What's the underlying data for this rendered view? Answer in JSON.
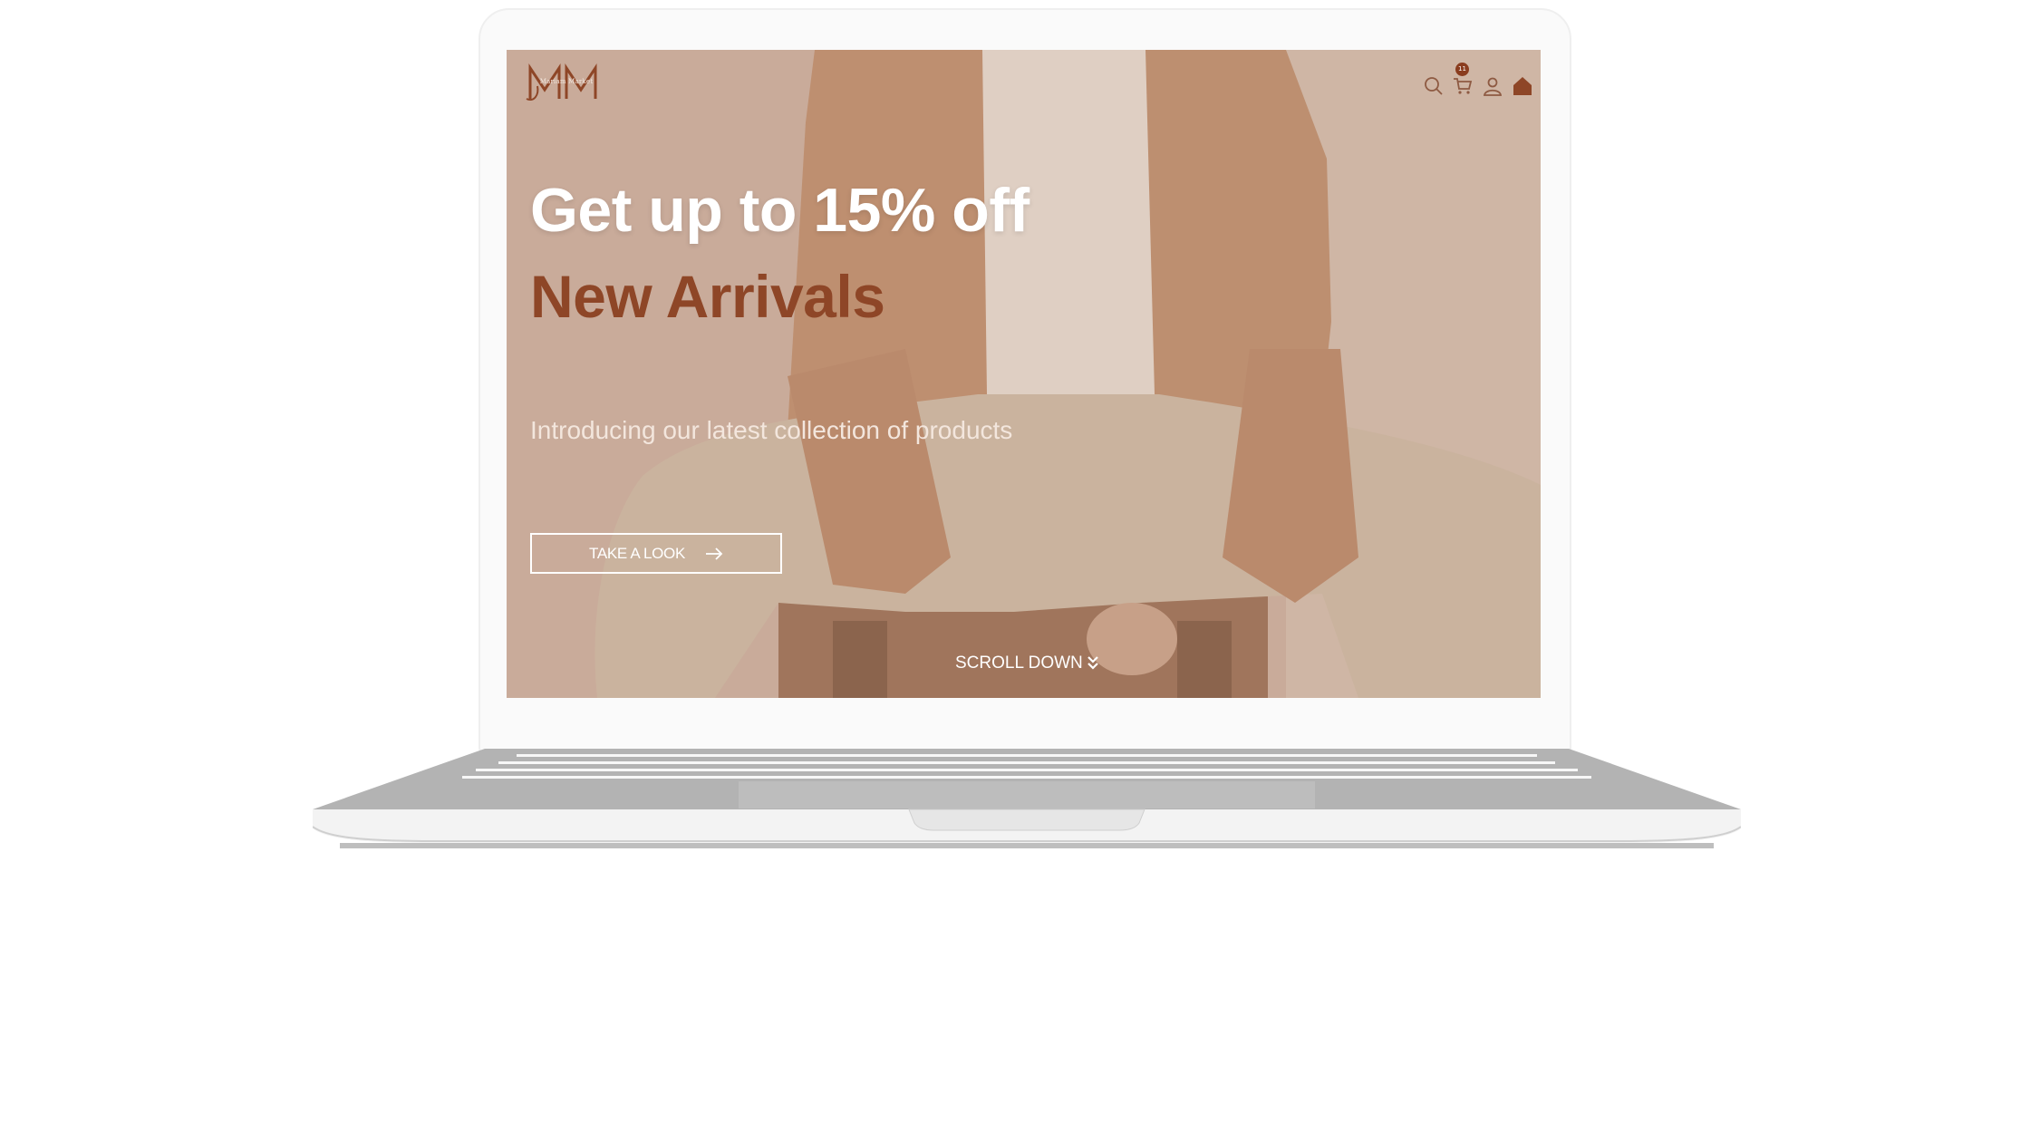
{
  "header": {
    "logo_text": "Mariam Market",
    "cart_count": "11",
    "icons": [
      "search-icon",
      "cart-icon",
      "user-icon",
      "home-icon"
    ]
  },
  "hero": {
    "title": "Get up to 15% off",
    "subtitle": "New Arrivals",
    "description": "Introducing our latest collection of products",
    "cta_label": "TAKE A LOOK",
    "scroll_label": "SCROLL DOWN"
  },
  "colors": {
    "accent": "#8e4627",
    "badge": "#8a3c1e",
    "hero_text": "#ffffff"
  }
}
